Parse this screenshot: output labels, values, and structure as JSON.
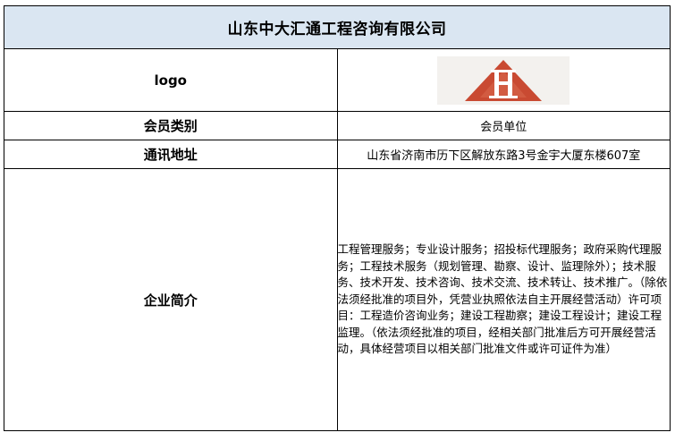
{
  "company": {
    "name": "山东中大汇通工程咨询有限公司"
  },
  "rows": {
    "logo_label": "logo",
    "member_type_label": "会员类别",
    "member_type_value": "会员单位",
    "address_label": "通讯地址",
    "address_value": "山东省济南市历下区解放东路3号金宇大厦东楼607室",
    "intro_label": "企业简介",
    "intro_value": "工程管理服务；专业设计服务；招投标代理服务；政府采购代理服务；工程技术服务（规划管理、勘察、设计、监理除外）；技术服务、技术开发、技术咨询、技术交流、技术转让、技术推广。（除依法须经批准的项目外，凭营业执照依法自主开展经营活动）许可项目：工程造价咨询业务；建设工程勘察；建设工程设计；建设工程监理。（依法须经批准的项目，经相关部门批准后方可开展经营活动，具体经营项目以相关部门批准文件或许可证件为准）"
  },
  "logo": {
    "icon": "triangle-h-logo-icon",
    "colors": {
      "background": "#f3f1ee",
      "triangle": "#c94a32",
      "letter": "#ffffff"
    }
  },
  "colors": {
    "title_background": "#dae6f2",
    "border": "#000000"
  }
}
